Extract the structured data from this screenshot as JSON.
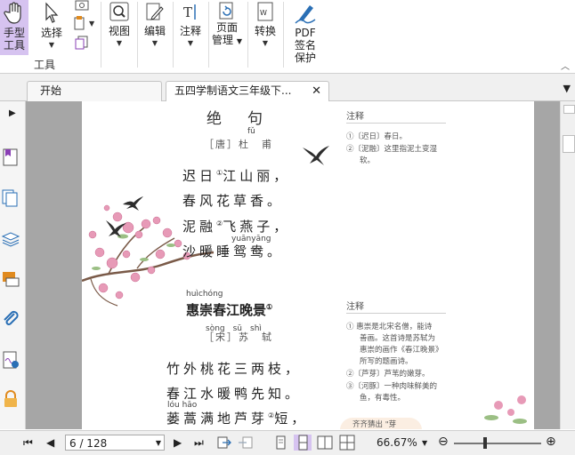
{
  "ribbon": {
    "hand_tool": {
      "line1": "手型",
      "line2": "工具"
    },
    "select": "选择",
    "view": "视图",
    "edit": "编辑",
    "comment": "注释",
    "page_mgmt": {
      "line1": "页面",
      "line2": "管理"
    },
    "convert": "转换",
    "pdf_sign": {
      "line1": "PDF",
      "line2": "签名",
      "line3": "保护"
    },
    "tools_group_label": "工具"
  },
  "tabs": [
    {
      "label": "开始"
    },
    {
      "label": "五四学制语文三年级下..."
    }
  ],
  "tab_close": "✕",
  "page": {
    "poem1": {
      "title": "绝　句",
      "author": "［唐］杜　甫",
      "title_pinyin": "fǔ",
      "lines": [
        "迟日",
        "江山丽，",
        "春风花草香。",
        "泥融",
        "飞燕子，",
        "沙暖睡鸳鸯。"
      ],
      "sup1": "①",
      "sup2": "②",
      "pinyin_yuanyang": "yuānyāng",
      "notes_head": "注释",
      "notes": [
        "①〔迟日〕春日。",
        "②〔泥融〕这里指泥土变湿",
        "软。"
      ]
    },
    "poem2": {
      "title_pinyin": "huìchóng",
      "title": "惠崇春江晚景",
      "title_sup": "①",
      "author_pinyin": "sòng　sū　shì",
      "author": "［宋］苏　轼",
      "lines": [
        "竹外桃花三两枝，",
        "春江水暖鸭先知。",
        "蒌蒿满地芦芽",
        "短，"
      ],
      "pinyin_louhao": "lóu hāo",
      "sup2": "②",
      "notes_head": "注释",
      "notes": [
        "① 惠崇是北宋名僧，能诗",
        "善画。这首诗是苏轼为",
        "惠崇的画作《春江晚景》",
        "所写的题画诗。",
        "②〔芦芽〕芦苇的嫩芽。",
        "③〔河豚〕一种肉味鲜美的",
        "鱼，有毒性。"
      ],
      "bottom_bubble": "齐齐猜出 \"芽"
    }
  },
  "status": {
    "page_indicator": "6 / 128",
    "zoom": "66.67%"
  },
  "colors": {
    "accent_selected": "#d6c3f0",
    "icon_blue": "#2a6fb5",
    "icon_orange": "#e08a1e",
    "icon_purple": "#8a3fb5",
    "doc_background": "#a6a6a6"
  }
}
